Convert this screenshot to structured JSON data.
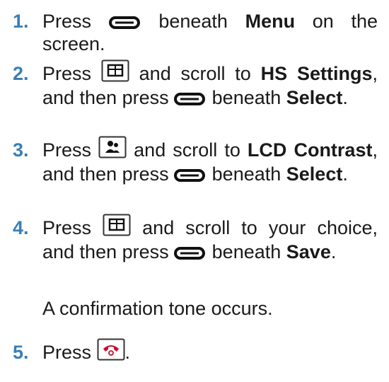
{
  "steps": [
    {
      "number": "1.",
      "parts": {
        "a": "Press",
        "b": "beneath",
        "c": "Menu",
        "d": "on the screen."
      }
    },
    {
      "number": "2.",
      "parts": {
        "a": "Press",
        "b": "and scroll to",
        "c": "HS Settings",
        "d": ", and then press",
        "e": "beneath",
        "f": "Select",
        "g": "."
      }
    },
    {
      "number": "3.",
      "parts": {
        "a": "Press",
        "b": "and scroll to",
        "c": "LCD Contrast",
        "d": ", and then press",
        "e": "beneath",
        "f": "Select",
        "g": "."
      }
    },
    {
      "number": "4.",
      "parts": {
        "a": "Press",
        "b": "and scroll to your choice, and then press",
        "c": "beneath",
        "d": "Save",
        "e": "."
      }
    },
    {
      "number": "5.",
      "parts": {
        "a": "Press",
        "b": "."
      }
    }
  ],
  "confirmation_note": "A confirmation tone occurs.",
  "icons": {
    "softkey": "softkey-button-icon",
    "menu_key": "menu-key-icon",
    "contacts_key": "contacts-key-icon",
    "end_call_key": "end-call-key-icon"
  },
  "colors": {
    "step_number": "#3a7fb5",
    "text": "#1a1a1a",
    "end_call_icon": "#c8102e"
  }
}
